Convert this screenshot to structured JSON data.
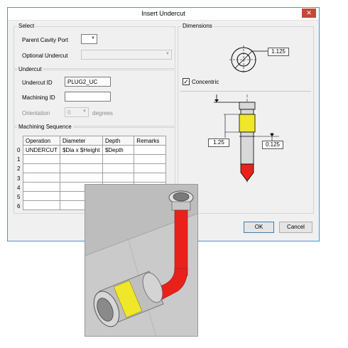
{
  "dialog": {
    "title": "Insert Undercut",
    "close_glyph": "✕"
  },
  "select_group": {
    "title": "Select",
    "parent_cavity_port_label": "Parent Cavity Port",
    "optional_undercut_label": "Optional Undercut"
  },
  "undercut_group": {
    "title": "Undercut",
    "undercut_id_label": "Undercut ID",
    "undercut_id_value": "PLUG2_UC",
    "machining_id_label": "Machining ID",
    "machining_id_value": "",
    "orientation_label": "Orientation",
    "orientation_value": "0",
    "degrees_label": "degrees"
  },
  "machining_sequence": {
    "title": "Machining Sequence",
    "columns": [
      "Operation",
      "Diameter",
      "Depth",
      "Remarks"
    ],
    "row_numbers": [
      "0",
      "1",
      "2",
      "3",
      "4",
      "5",
      "6"
    ],
    "rows": [
      [
        "UNDERCUT",
        "$Dia x $Height",
        "$Depth",
        ""
      ],
      [
        "",
        "",
        "",
        ""
      ],
      [
        "",
        "",
        "",
        ""
      ],
      [
        "",
        "",
        "",
        ""
      ],
      [
        "",
        "",
        "",
        ""
      ],
      [
        "",
        "",
        "",
        ""
      ],
      [
        "",
        "",
        "",
        ""
      ]
    ]
  },
  "dimensions_group": {
    "title": "Dimensions",
    "diameter_value": "1.125",
    "concentric_label": "Concentric",
    "concentric_checked": true,
    "check_glyph": "✓",
    "height_value": "1.25",
    "depth_value": "0.125"
  },
  "buttons": {
    "ok": "OK",
    "cancel": "Cancel"
  },
  "colors": {
    "highlight_red": "#e8221b",
    "highlight_yellow": "#f0e62a",
    "window_border": "#3c9bd5"
  },
  "icons": {
    "close": "close-icon",
    "dropdown": "chevron-down-icon",
    "checkbox": "checkmark-icon"
  }
}
